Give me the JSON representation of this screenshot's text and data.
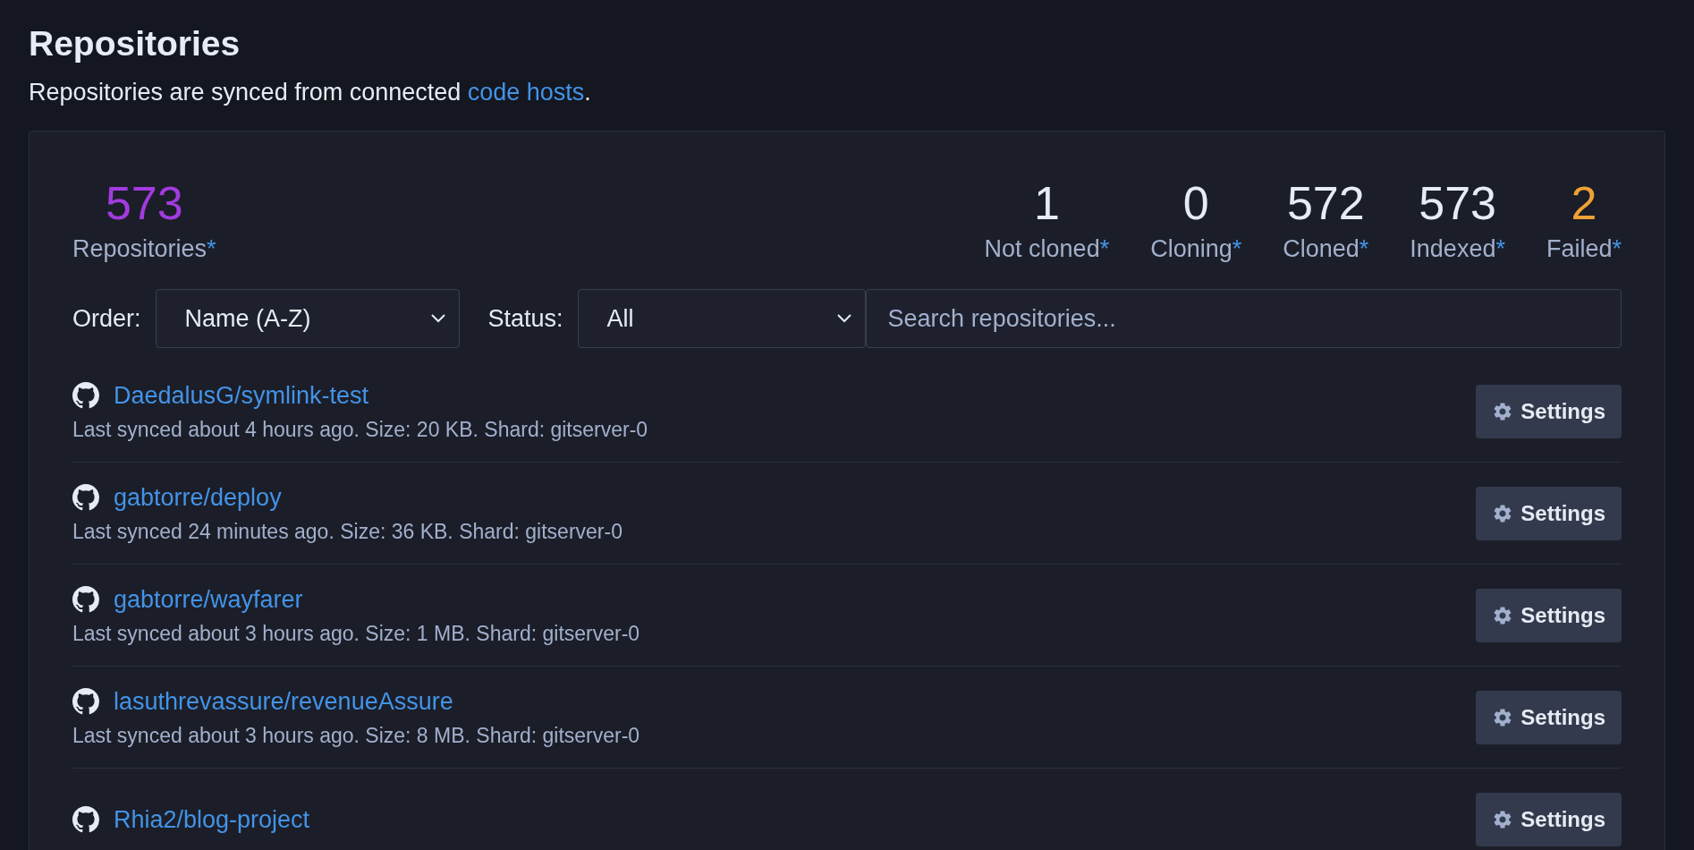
{
  "header": {
    "title": "Repositories",
    "description": {
      "text": "Repositories are synced from connected ",
      "link": "code hosts",
      "end": "."
    }
  },
  "stats": [
    {
      "value": "573",
      "label": "Repositories",
      "mark": "*",
      "color": "#a23be0"
    },
    {
      "value": "1",
      "label": "Not cloned",
      "mark": "*",
      "color": "#e6ebf4"
    },
    {
      "value": "0",
      "label": "Cloning",
      "mark": "*",
      "color": "#e6ebf4"
    },
    {
      "value": "572",
      "label": "Cloned",
      "mark": "*",
      "color": "#e6ebf4"
    },
    {
      "value": "573",
      "label": "Indexed",
      "mark": "*",
      "color": "#e6ebf4"
    },
    {
      "value": "2",
      "label": "Failed",
      "mark": "*",
      "color": "#f0a134"
    }
  ],
  "filters": {
    "order": {
      "label": "Order:",
      "value": "Name (A-Z)"
    },
    "status": {
      "label": "Status:",
      "value": "All"
    },
    "search": {
      "placeholder": "Search repositories..."
    }
  },
  "repositories": [
    {
      "name": "DaedalusG/symlink-test",
      "meta": "Last synced about 4 hours ago. Size: 20 KB. Shard: gitserver-0",
      "button": "Settings"
    },
    {
      "name": "gabtorre/deploy",
      "meta": "Last synced 24 minutes ago. Size: 36 KB. Shard: gitserver-0",
      "button": "Settings"
    },
    {
      "name": "gabtorre/wayfarer",
      "meta": "Last synced about 3 hours ago. Size: 1 MB. Shard: gitserver-0",
      "button": "Settings"
    },
    {
      "name": "lasuthrevassure/revenueAssure",
      "meta": "Last synced about 3 hours ago. Size: 8 MB. Shard: gitserver-0",
      "button": "Settings"
    },
    {
      "name": "Rhia2/blog-project",
      "button": "Settings"
    }
  ]
}
